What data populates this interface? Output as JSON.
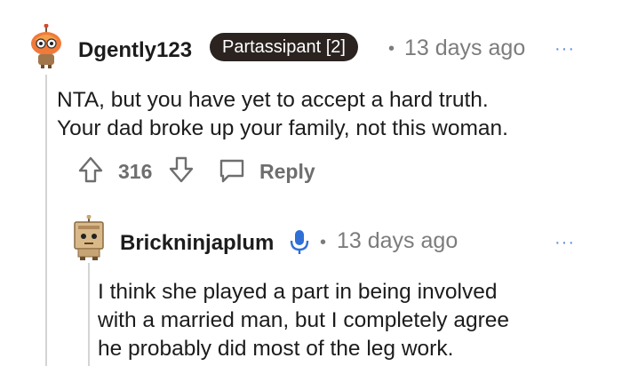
{
  "comment": {
    "username": "Dgently123",
    "flair": "Partassipant [2]",
    "separator": "•",
    "time": "13 days ago",
    "more": "···",
    "body_lines": [
      "NTA, but you have yet to accept a hard truth.",
      "Your dad broke up your family, not this woman."
    ],
    "score": "316",
    "reply_label": "Reply"
  },
  "reply": {
    "username": "Brickninjaplum",
    "separator": "•",
    "time": "13 days ago",
    "more": "···",
    "body_lines": [
      "I think she played a part in being involved",
      "with a married man, but I completely agree",
      "he probably did most of the leg work."
    ]
  },
  "colors": {
    "flair_bg": "#2b2320",
    "meta_gray": "#7c7c7c",
    "more_blue": "#5f8fd6",
    "mic_blue": "#2f6fd8",
    "thread_line": "#d4d4d4"
  },
  "icons": [
    "robot-avatar-icon",
    "upvote-icon",
    "downvote-icon",
    "comment-icon",
    "box-avatar-icon",
    "microphone-icon"
  ]
}
